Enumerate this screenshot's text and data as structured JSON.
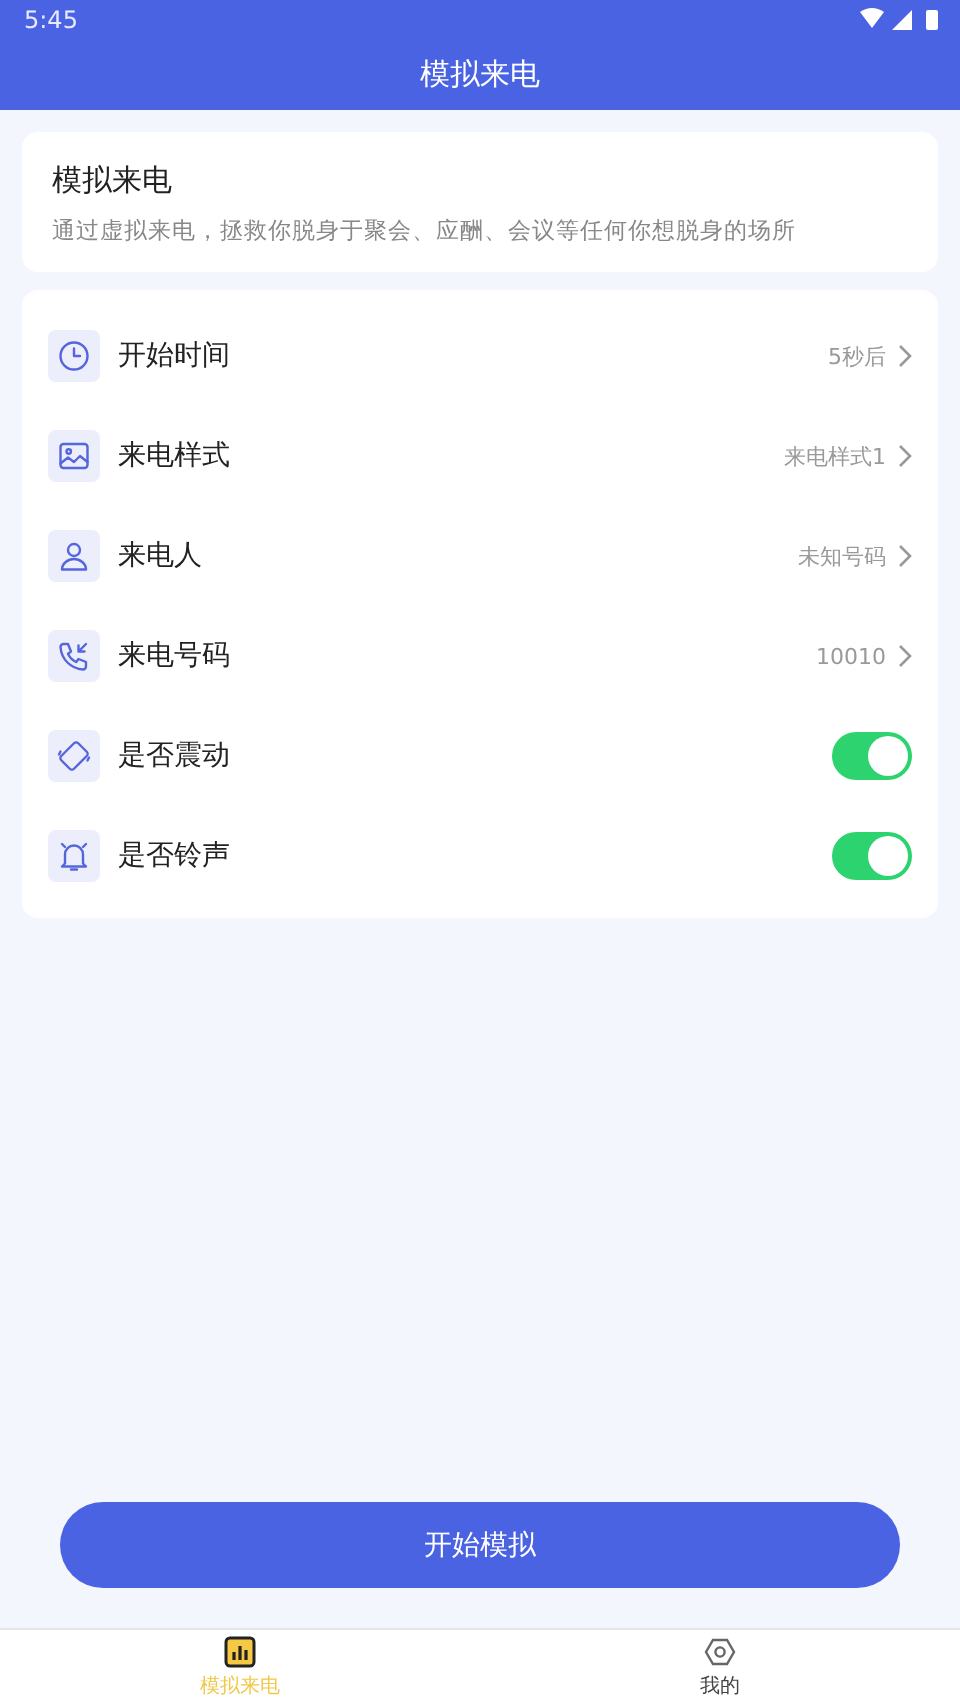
{
  "status_bar": {
    "time": "5:45"
  },
  "header": {
    "title": "模拟来电"
  },
  "intro": {
    "title": "模拟来电",
    "description": "通过虚拟来电，拯救你脱身于聚会、应酬、会议等任何你想脱身的场所"
  },
  "settings": [
    {
      "kind": "link",
      "label": "开始时间",
      "value": "5秒后"
    },
    {
      "kind": "link",
      "label": "来电样式",
      "value": "来电样式1"
    },
    {
      "kind": "link",
      "label": "来电人",
      "value": "未知号码"
    },
    {
      "kind": "link",
      "label": "来电号码",
      "value": "10010"
    },
    {
      "kind": "toggle",
      "label": "是否震动",
      "on": true
    },
    {
      "kind": "toggle",
      "label": "是否铃声",
      "on": true
    }
  ],
  "start_button": "开始模拟",
  "tabs": [
    {
      "label": "模拟来电",
      "selected": true
    },
    {
      "label": "我的",
      "selected": false
    }
  ]
}
